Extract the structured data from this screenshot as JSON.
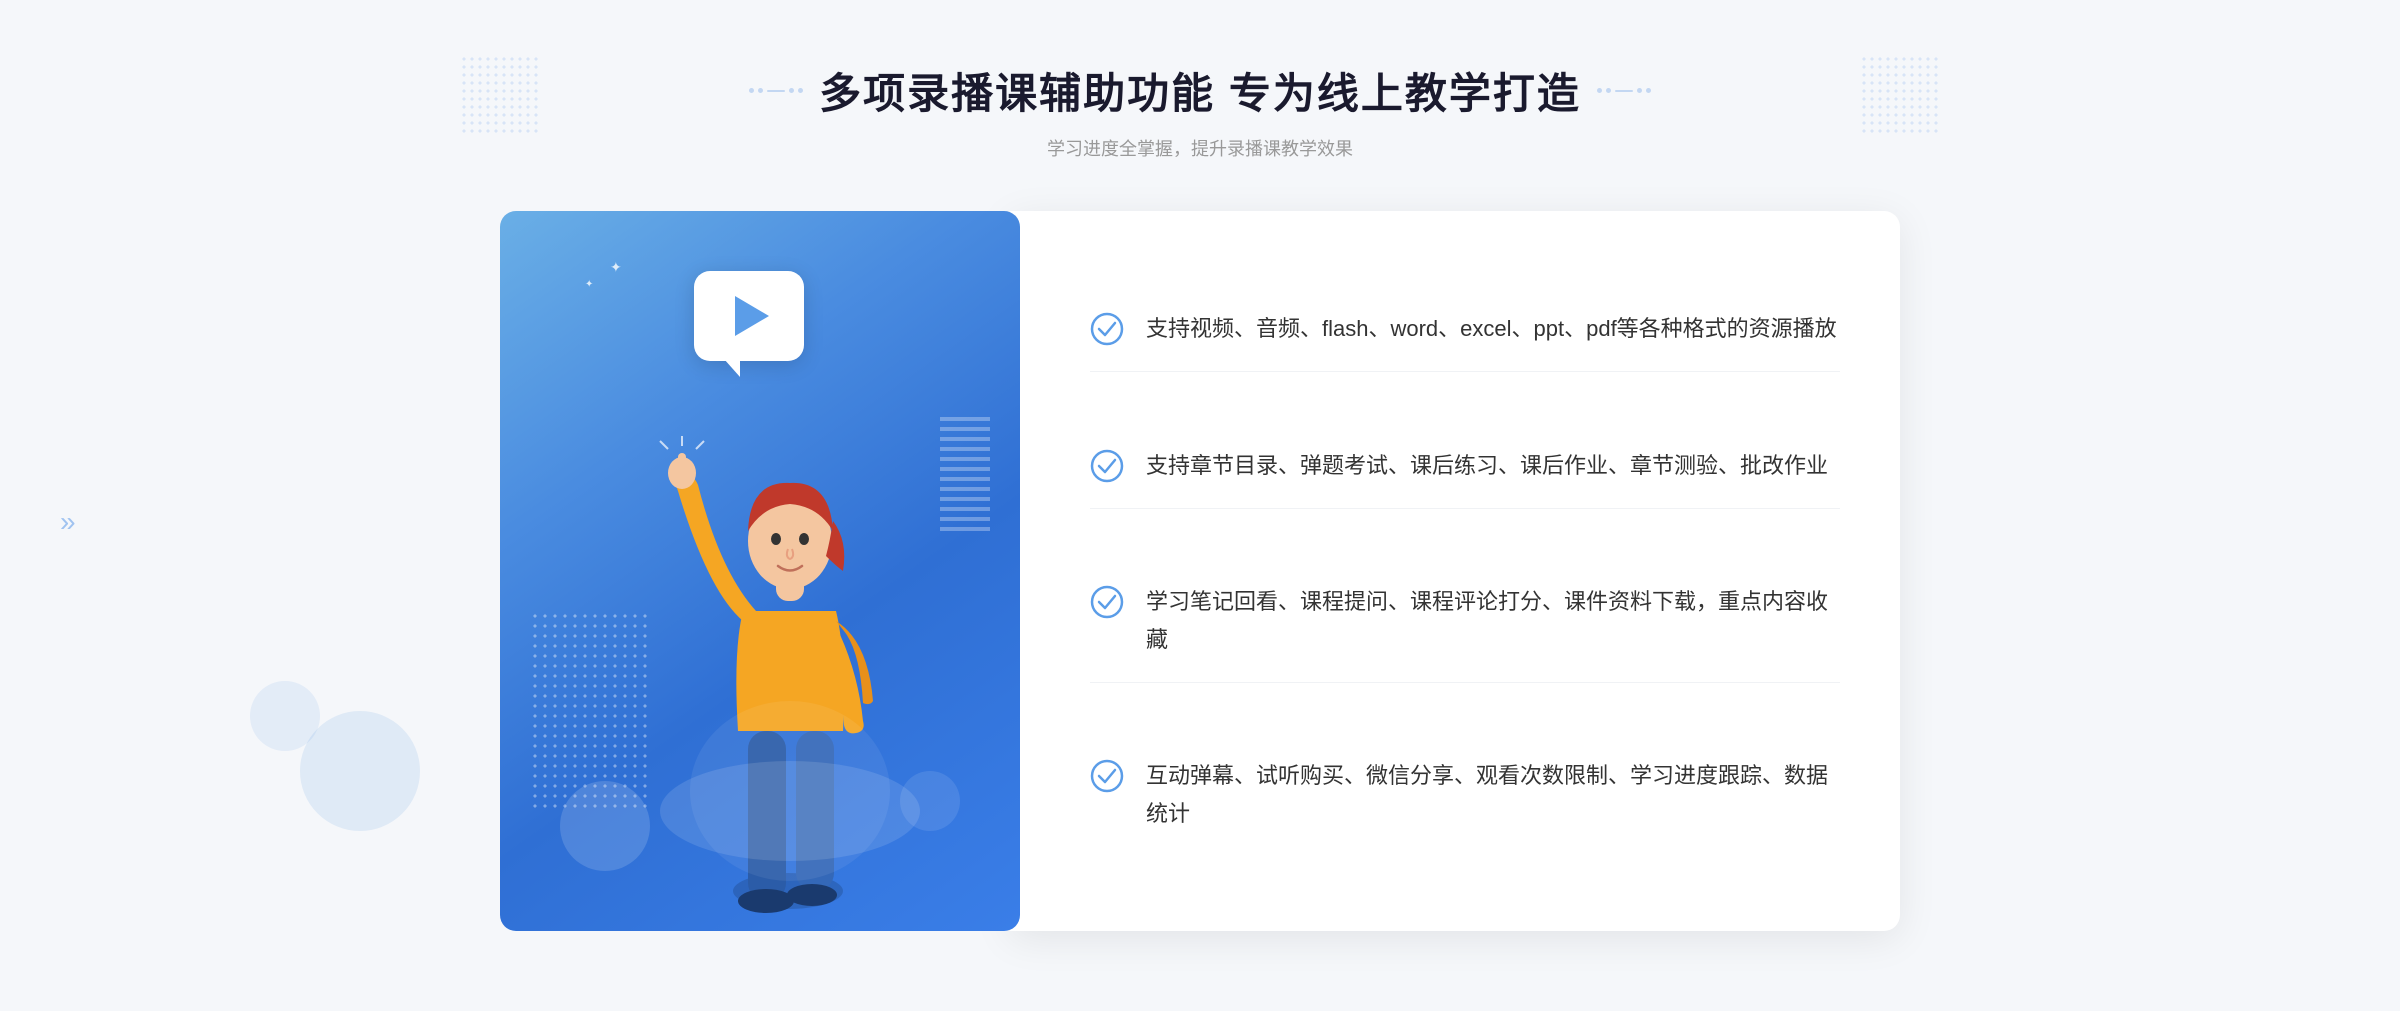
{
  "header": {
    "main_title": "多项录播课辅助功能 专为线上教学打造",
    "sub_title": "学习进度全掌握，提升录播课教学效果"
  },
  "features": [
    {
      "id": "feature-1",
      "text": "支持视频、音频、flash、word、excel、ppt、pdf等各种格式的资源播放"
    },
    {
      "id": "feature-2",
      "text": "支持章节目录、弹题考试、课后练习、课后作业、章节测验、批改作业"
    },
    {
      "id": "feature-3",
      "text": "学习笔记回看、课程提问、课程评论打分、课件资料下载，重点内容收藏"
    },
    {
      "id": "feature-4",
      "text": "互动弹幕、试听购买、微信分享、观看次数限制、学习进度跟踪、数据统计"
    }
  ],
  "colors": {
    "accent": "#4a8ce0",
    "title": "#1a1a2e",
    "text": "#333333",
    "subtitle": "#999999",
    "check": "#5b9de8"
  }
}
